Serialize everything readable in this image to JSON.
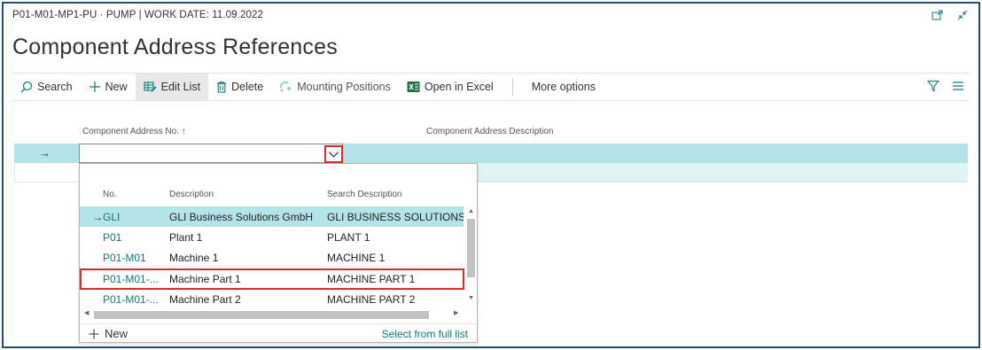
{
  "header": {
    "context": "P01-M01-MP1-PU · PUMP | WORK DATE: 11.09.2022",
    "title": "Component Address References"
  },
  "toolbar": {
    "search": "Search",
    "new": "New",
    "edit_list": "Edit List",
    "delete": "Delete",
    "mounting_positions": "Mounting Positions",
    "open_in_excel": "Open in Excel",
    "more_options": "More options"
  },
  "list": {
    "col_no": "Component Address No. ↑",
    "col_desc": "Component Address Description",
    "current_row_marker": "→",
    "input_value": ""
  },
  "lookup": {
    "headers": {
      "no": "No.",
      "description": "Description",
      "search_description": "Search Description"
    },
    "rows": [
      {
        "marker": "→",
        "no": "GLI",
        "description": "GLI Business Solutions GmbH",
        "search_description": "GLI BUSINESS SOLUTIONS GN"
      },
      {
        "marker": "",
        "no": "P01",
        "description": "Plant 1",
        "search_description": "PLANT 1"
      },
      {
        "marker": "",
        "no": "P01-M01",
        "description": "Machine 1",
        "search_description": "MACHINE 1"
      },
      {
        "marker": "",
        "no": "P01-M01-...",
        "description": "Machine Part 1",
        "search_description": "MACHINE PART 1"
      },
      {
        "marker": "",
        "no": "P01-M01-...",
        "description": "Machine Part 2",
        "search_description": "MACHINE PART 2"
      }
    ],
    "new_label": "New",
    "full_list_label": "Select from full list"
  },
  "colors": {
    "accent": "#0f7b7b",
    "selected_row": "#b4e3e8",
    "highlight_border": "#d32f2f"
  }
}
